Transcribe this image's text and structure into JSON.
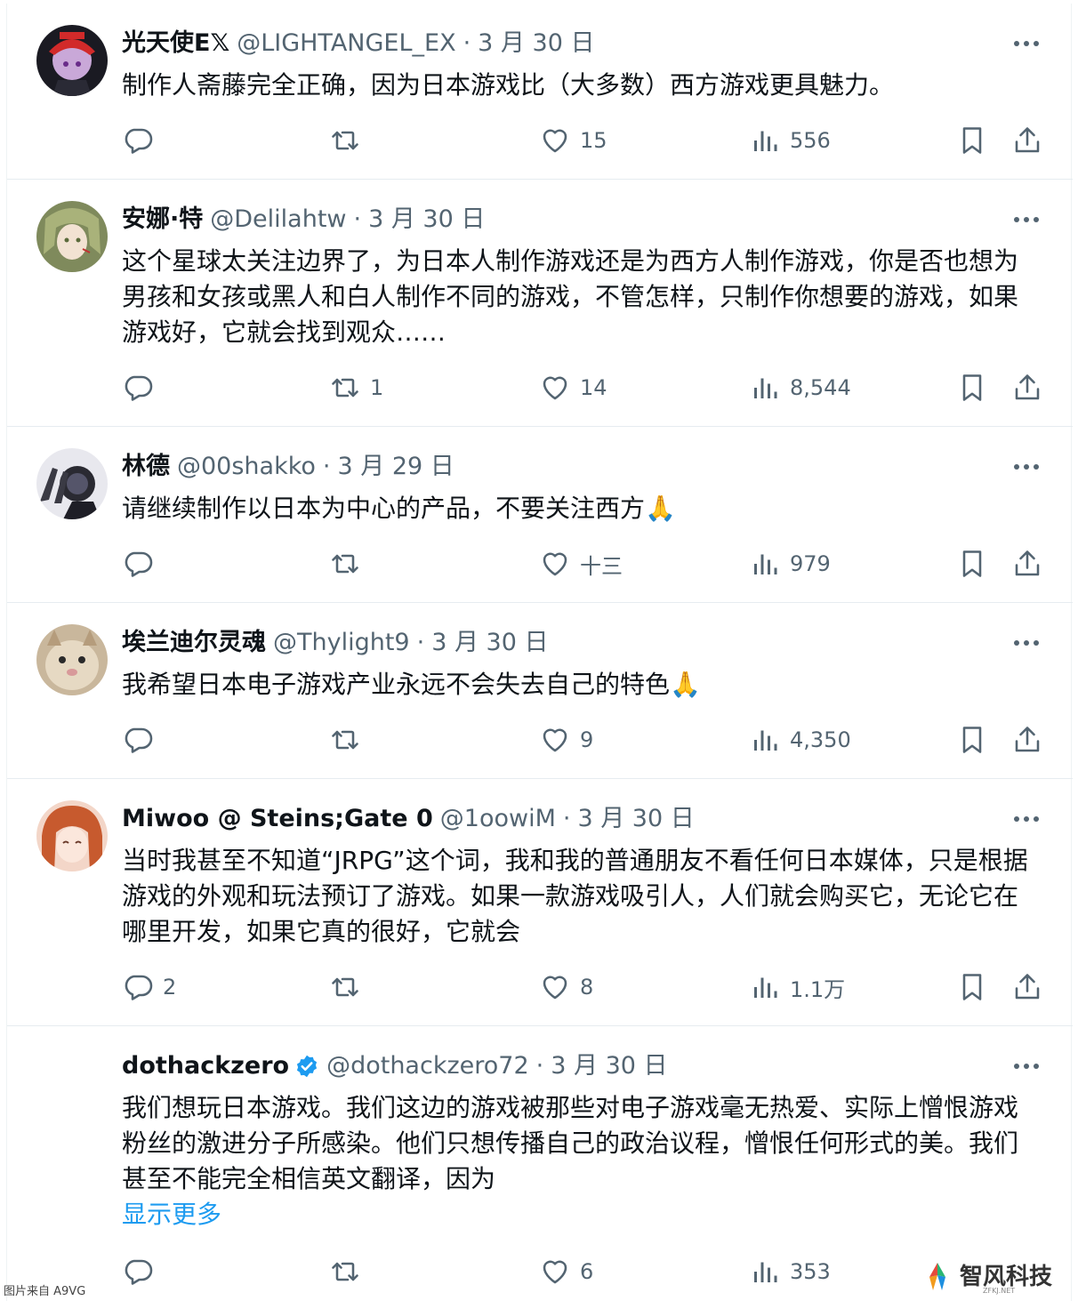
{
  "tweets": [
    {
      "name": "光天使E𝕏",
      "handle": "@LIGHTANGEL_EX",
      "date": "3 月 30 日",
      "text": "制作人斋藤完全正确，因为日本游戏比（大多数）西方游戏更具魅力。",
      "replies": "",
      "retweets": "",
      "likes": "15",
      "views": "556"
    },
    {
      "name": "安娜·特",
      "handle": "@Delilahtw",
      "date": "3 月 30 日",
      "text": "这个星球太关注边界了，为日本人制作游戏还是为西方人制作游戏，你是否也想为男孩和女孩或黑人和白人制作不同的游戏，不管怎样，只制作你想要的游戏，如果游戏好，它就会找到观众……",
      "replies": "",
      "retweets": "1",
      "likes": "14",
      "views": "8,544"
    },
    {
      "name": "林德",
      "handle": "@00shakko",
      "date": "3 月 29 日",
      "text": "请继续制作以日本为中心的产品，不要关注西方🙏",
      "replies": "",
      "retweets": "",
      "likes": "十三",
      "views": "979"
    },
    {
      "name": "埃兰迪尔灵魂",
      "handle": "@Thylight9",
      "date": "3 月 30 日",
      "text": "我希望日本电子游戏产业永远不会失去自己的特色🙏",
      "replies": "",
      "retweets": "",
      "likes": "9",
      "views": "4,350"
    },
    {
      "name": "Miwoo @ Steins;Gate 0",
      "handle": "@1oowiM",
      "date": "3 月 30 日",
      "text": "当时我甚至不知道“JRPG”这个词，我和我的普通朋友不看任何日本媒体，只是根据游戏的外观和玩法预订了游戏。如果一款游戏吸引人，人们就会购买它，无论它在哪里开发，如果它真的很好，它就会",
      "replies": "2",
      "retweets": "",
      "likes": "8",
      "views": "1.1万"
    },
    {
      "name": "dothackzero",
      "handle": "@dothackzero72",
      "date": "3 月 30 日",
      "text": "我们想玩日本游戏。我们这边的游戏被那些对电子游戏毫无热爱、实际上憎恨游戏粉丝的激进分子所感染。他们只想传播自己的政治议程，憎恨任何形式的美。我们甚至不能完全相信英文翻译，因为",
      "show_more": "显示更多",
      "replies": "",
      "retweets": "",
      "likes": "6",
      "views": "353"
    }
  ],
  "footer": {
    "source": "图片来自 A9VG"
  },
  "watermark": {
    "brand": "智风科技",
    "domain": "ZFKJ.NET"
  },
  "colors": {
    "text": "#0f1419",
    "secondary": "#536471",
    "link": "#1d9bf0",
    "verified": "#1d9bf0"
  }
}
